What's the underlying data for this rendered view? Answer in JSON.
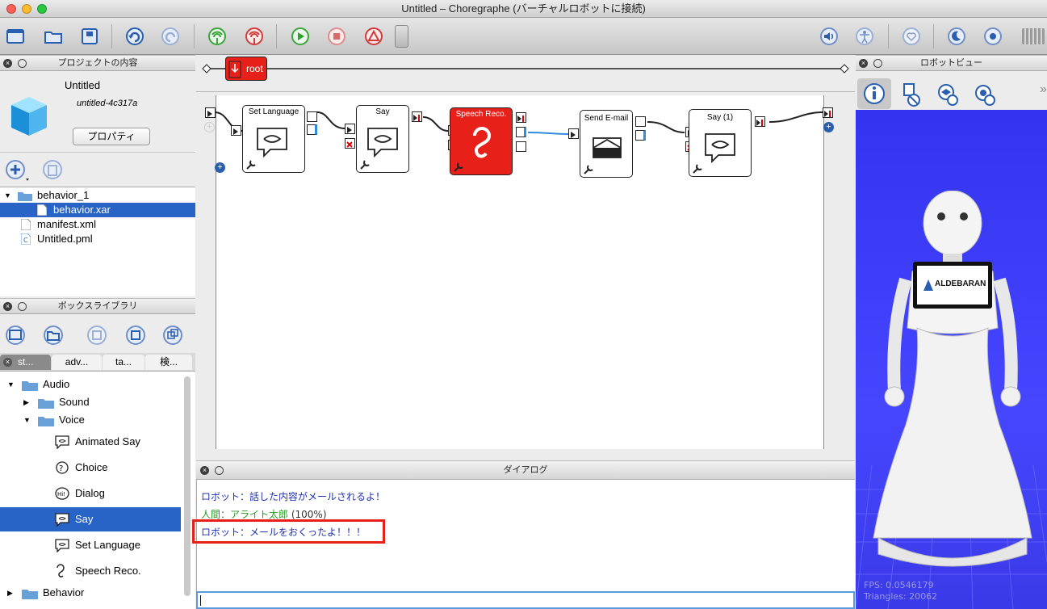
{
  "window": {
    "title": "Untitled – Choregraphe (バーチャルロボットに接続)"
  },
  "project_panel": {
    "title": "プロジェクトの内容",
    "project_name": "Untitled",
    "project_id": "untitled-4c317a",
    "properties_button": "プロパティ",
    "files": [
      {
        "label": "behavior_1",
        "type": "folder"
      },
      {
        "label": "behavior.xar",
        "type": "file"
      },
      {
        "label": "manifest.xml",
        "type": "file"
      },
      {
        "label": "Untitled.pml",
        "type": "file"
      }
    ]
  },
  "library_panel": {
    "title": "ボックスライブラリ",
    "tabs": [
      "st...",
      "adv...",
      "ta...",
      "検..."
    ],
    "items": [
      {
        "label": "Audio"
      },
      {
        "label": "Sound"
      },
      {
        "label": "Voice"
      },
      {
        "label": "Animated Say"
      },
      {
        "label": "Choice"
      },
      {
        "label": "Dialog"
      },
      {
        "label": "Say"
      },
      {
        "label": "Set Language"
      },
      {
        "label": "Speech Reco."
      },
      {
        "label": "Behavior"
      }
    ]
  },
  "flow": {
    "breadcrumb": "root",
    "boxes": [
      "Set Language",
      "Say",
      "Speech Reco.",
      "Send E-mail",
      "Say (1)"
    ]
  },
  "dialog_panel": {
    "title": "ダイアログ",
    "lines": [
      {
        "speaker": "ロボット",
        "text": "ロボット：話した内容がメールされるよ！"
      },
      {
        "speaker": "人間",
        "text": "人間：アライト太郎",
        "confidence": "(100%)"
      },
      {
        "speaker": "ロボット",
        "text": "ロボット：メールをおくったよ！！！"
      }
    ],
    "input_value": ""
  },
  "robot_view": {
    "title": "ロボットビュー",
    "brand": "ALDEBARAN",
    "fps": "FPS: 0.0546179",
    "triangles": "Triangles: 20062"
  },
  "colors": {
    "selection": "#2863c6",
    "highlight_box": "#e8201a",
    "robot_bg": "#3b3bf4"
  }
}
